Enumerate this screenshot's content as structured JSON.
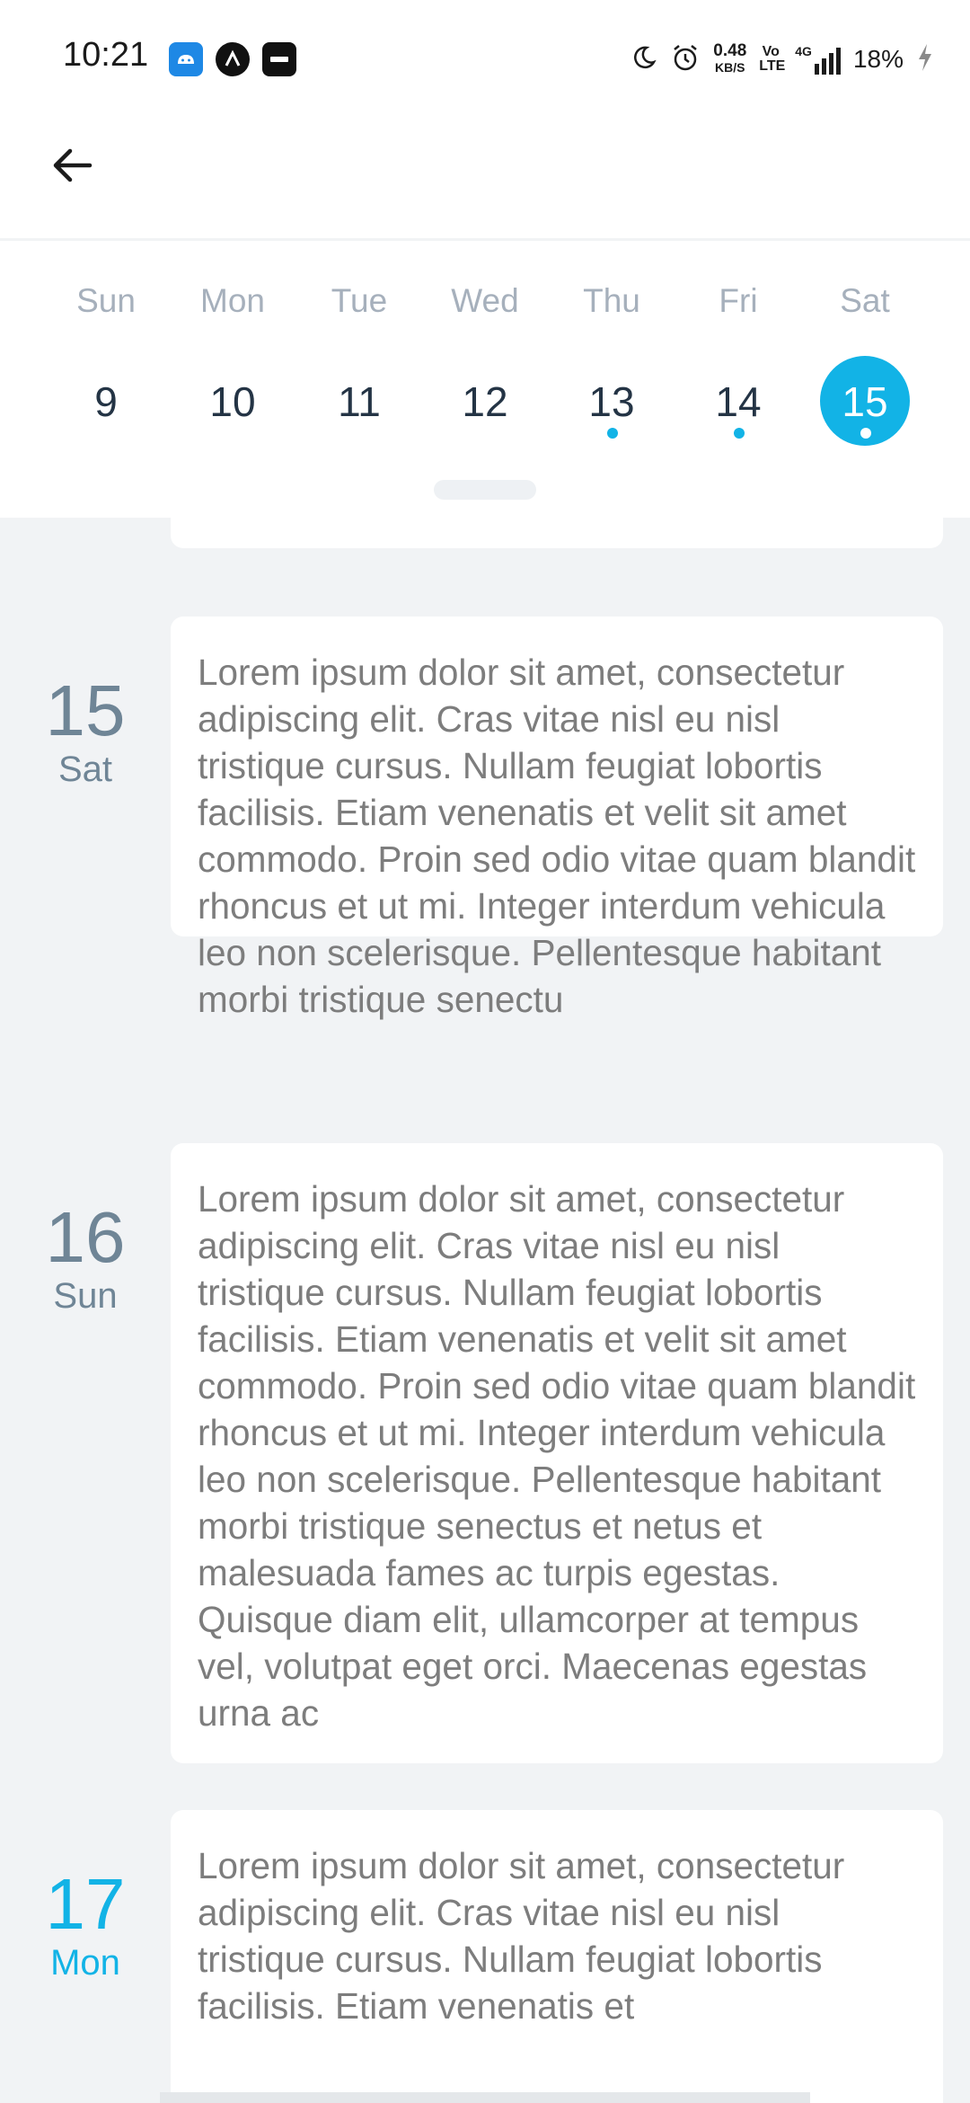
{
  "status_bar": {
    "time": "10:21",
    "net_speed": "0.48",
    "net_unit": "KB/S",
    "volte": "Vo LTE",
    "network": "4G",
    "battery": "18%"
  },
  "topbar": {
    "back_icon": "arrow-left-icon"
  },
  "week": {
    "days": [
      {
        "dow": "Sun",
        "num": "9"
      },
      {
        "dow": "Mon",
        "num": "10"
      },
      {
        "dow": "Tue",
        "num": "11"
      },
      {
        "dow": "Wed",
        "num": "12"
      },
      {
        "dow": "Thu",
        "num": "13"
      },
      {
        "dow": "Fri",
        "num": "14"
      },
      {
        "dow": "Sat",
        "num": "15"
      }
    ],
    "accent_color": "#12b3e6"
  },
  "agenda": {
    "entries": [
      {
        "num": "15",
        "dow": "Sat",
        "text": "Lorem ipsum dolor sit amet, consectetur adipiscing elit. Cras vitae nisl eu nisl tristique cursus. Nullam feugiat lobortis facilisis. Etiam venenatis et velit sit amet commodo. Proin sed odio vitae quam blandit rhoncus et ut mi. Integer interdum vehicula leo non scelerisque. Pellentesque habitant morbi tristique senectu"
      },
      {
        "num": "16",
        "dow": "Sun",
        "text": "Lorem ipsum dolor sit amet, consectetur adipiscing elit. Cras vitae nisl eu nisl tristique cursus. Nullam feugiat lobortis facilisis. Etiam venenatis et velit sit amet commodo. Proin sed odio vitae quam blandit rhoncus et ut mi. Integer interdum vehicula leo non scelerisque. Pellentesque habitant morbi tristique senectus et netus et malesuada fames ac turpis egestas. Quisque diam elit, ullamcorper at tempus vel, volutpat eget orci. Maecenas egestas urna ac"
      },
      {
        "num": "17",
        "dow": "Mon",
        "text": "Lorem ipsum dolor sit amet, consectetur adipiscing elit. Cras vitae nisl eu nisl tristique cursus. Nullam feugiat lobortis facilisis. Etiam venenatis et"
      }
    ]
  }
}
